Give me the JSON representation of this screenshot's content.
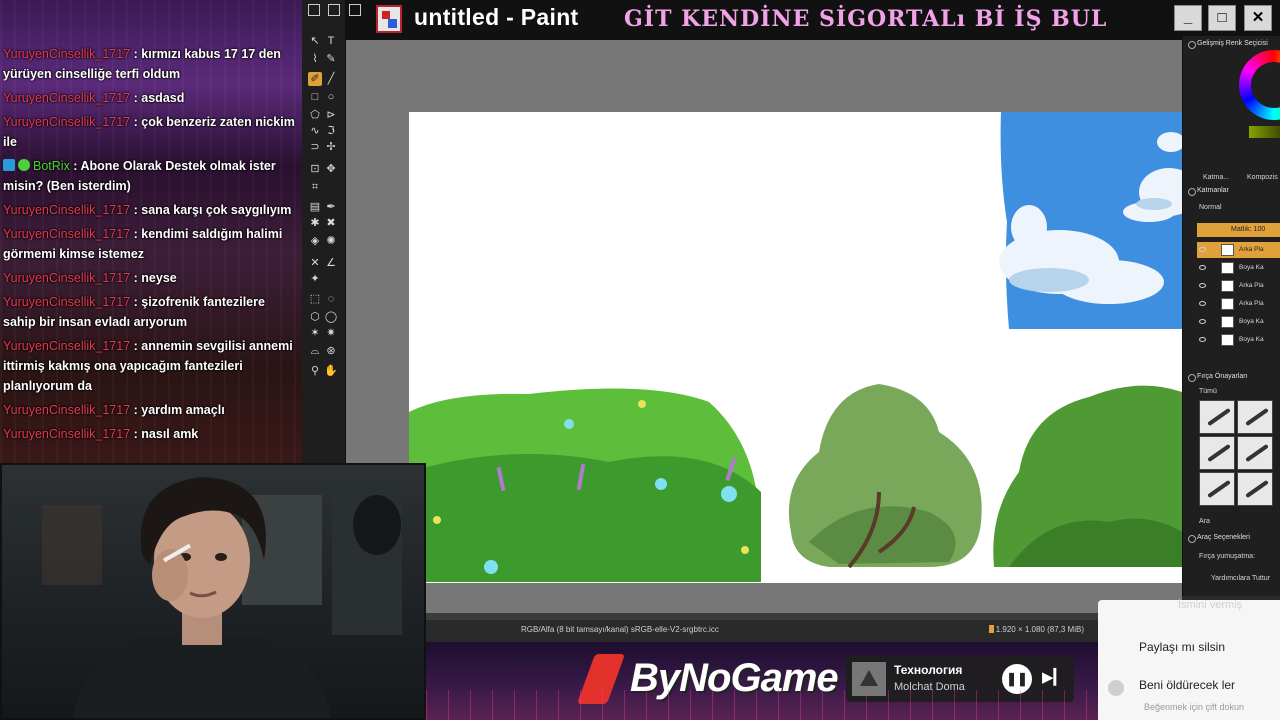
{
  "window": {
    "title": "untitled - Paint",
    "banner": "GİT KENDİNE SİGORTALı Bİ İŞ BUL",
    "controls": [
      "minimize",
      "maximize",
      "close"
    ]
  },
  "chat": {
    "messages": [
      {
        "user": "YuruyenCinsellik_1717",
        "text": "kırmızı kabus 17 17 den yürüyen cinselliğe terfi oldum"
      },
      {
        "user": "YuruyenCinsellik_1717",
        "text": "asdasd"
      },
      {
        "user": "YuruyenCinsellik_1717",
        "text": "çok benzeriz zaten nickim ile"
      },
      {
        "user": "BotRix",
        "bot": true,
        "text": "Abone Olarak Destek olmak ister misin? (Ben isterdim)"
      },
      {
        "user": "YuruyenCinsellik_1717",
        "text": "sana karşı çok saygılıyım"
      },
      {
        "user": "YuruyenCinsellik_1717",
        "text": "kendimi saldığım halimi görmemi kimse istemez"
      },
      {
        "user": "YuruyenCinsellik_1717",
        "text": "neyse"
      },
      {
        "user": "YuruyenCinsellik_1717",
        "text": "şizofrenik fantezilere sahip bir insan evladı arıyorum"
      },
      {
        "user": "YuruyenCinsellik_1717",
        "text": "annemin sevgilisi annemi ittirmiş kakmış ona yapıcağım fantezileri planlıyorum da"
      },
      {
        "user": "YuruyenCinsellik_1717",
        "text": "yardım amaçlı"
      },
      {
        "user": "YuruyenCinsellik_1717",
        "text": "nasıl amk"
      }
    ]
  },
  "statusbar": {
    "color_info": "RGB/Alfa (8 bit tamsayı/kanal) sRGB-elle-V2-srgbtrc.icc",
    "doc_info": "1.920 × 1.080 (87,3 MiB)"
  },
  "docker": {
    "color_title": "Gelişmiş Renk Seçicisi",
    "tabs": [
      "Katma...",
      "Kompozis"
    ],
    "layers_title": "Katmanlar",
    "blend_mode": "Normal",
    "opacity_label": "Matlık: 100",
    "layers": [
      {
        "name": "Arka Pla",
        "active": true
      },
      {
        "name": "Boya Ka"
      },
      {
        "name": "Arka Pla"
      },
      {
        "name": "Arka Pla"
      },
      {
        "name": "Boya Ka"
      },
      {
        "name": "Boya Ka"
      }
    ],
    "brush_title": "Fırça Önayarları",
    "brush_filter": "Tümü",
    "search_label": "Ara",
    "tool_options_title": "Araç Seçenekleri",
    "smoothing_label": "Fırça yumuşatma:",
    "assist_label": "Yardımcılara Tuttur"
  },
  "stream_bar": {
    "logo": "ByNoGame",
    "track_title": "Технология",
    "track_artist": "Molchat Doma",
    "pause_icon": "pause-icon",
    "next_icon": "skip-next-icon"
  },
  "notification": {
    "header": "İsmini vermiş",
    "line1": "Paylaşı mı silsin",
    "line2": "Beni öldürecek ler",
    "hint": "Beğenmek için çift dokun"
  },
  "colors": {
    "accent": "#e1a13a",
    "chat_username": "#e23a4f",
    "bot_name": "#4cd13b",
    "banner_pink": "#f2a3e8",
    "sky_blue": "#3f8fe0"
  }
}
